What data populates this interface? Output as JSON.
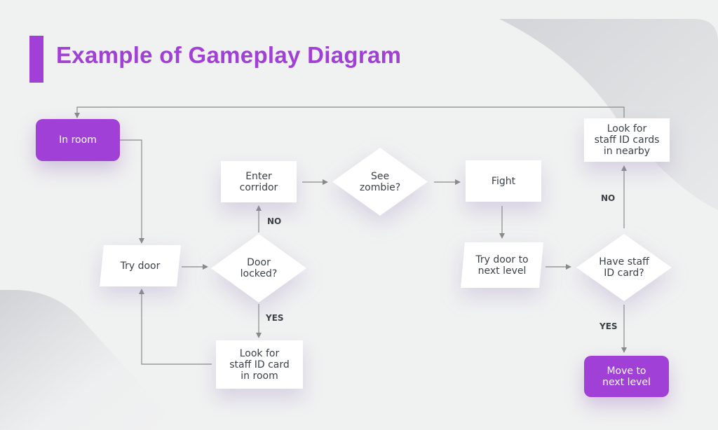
{
  "title": "Example of Gameplay Diagram",
  "colors": {
    "accent": "#a040d6",
    "background": "#f0f1f1",
    "node_fill": "#ffffff",
    "text": "#3b4147",
    "connector": "#8a8a8a"
  },
  "nodes": {
    "in_room": "In room",
    "try_door": "Try door",
    "door_locked": "Door\nlocked?",
    "enter_corridor": "Enter\ncorridor",
    "see_zombie": "See\nzombie?",
    "fight": "Fight",
    "look_staff_card_room": "Look for\nstaff ID card\nin room",
    "try_door_next_level": "Try door to\nnext level",
    "have_staff_card": "Have staff\nID card?",
    "look_staff_cards_nearby": "Look for\nstaff ID cards\nin nearby",
    "move_next_level": "Move to\nnext level"
  },
  "edge_labels": {
    "door_locked_no": "NO",
    "door_locked_yes": "YES",
    "have_card_no": "NO",
    "have_card_yes": "YES"
  }
}
